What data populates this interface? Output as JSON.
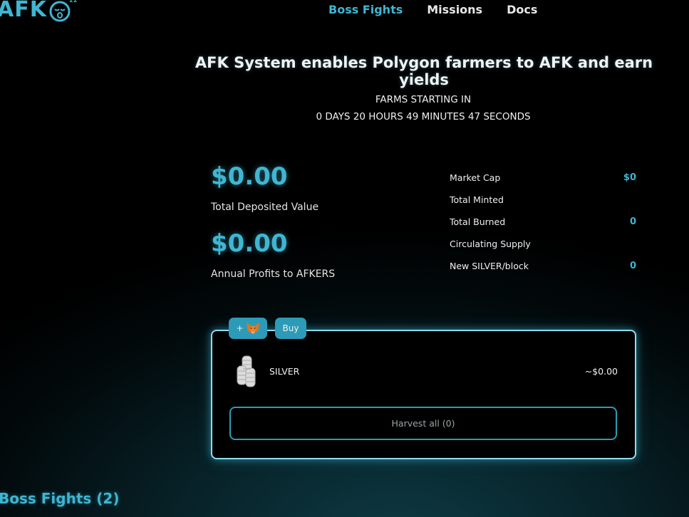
{
  "brand": {
    "logo_text": "AFK",
    "logo_sup": "zz",
    "accent": "#3fb6d2"
  },
  "nav": {
    "items": [
      "Boss Fights",
      "Missions",
      "Docs"
    ],
    "active": "Boss Fights"
  },
  "hero": {
    "headline": "AFK System enables Polygon farmers to AFK and earn yields",
    "countdown_label": "FARMS STARTING IN",
    "countdown_value": "0 DAYS 20 HOURS 49 MINUTES 47 SECONDS"
  },
  "totals": {
    "deposited_value": "$0.00",
    "deposited_label": "Total Deposited Value",
    "annual_profits": "$0.00",
    "annual_label": "Annual Profits to AFKERS"
  },
  "stats": [
    {
      "label": "Market Cap",
      "value": "$0"
    },
    {
      "label": "Total Minted",
      "value": ""
    },
    {
      "label": "Total Burned",
      "value": "0"
    },
    {
      "label": "Circulating Supply",
      "value": ""
    },
    {
      "label": "New SILVER/block",
      "value": "0"
    }
  ],
  "panel": {
    "add_label": "+",
    "buy_label": "Buy",
    "token_name": "SILVER",
    "token_usd": "~$0.00",
    "harvest_label": "Harvest all (0)"
  },
  "section": {
    "title": "Boss Fights (2)"
  }
}
